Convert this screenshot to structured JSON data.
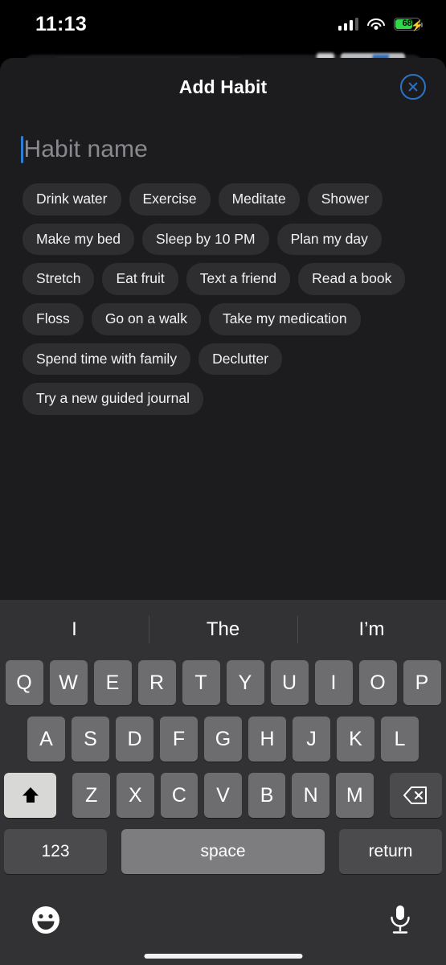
{
  "statusbar": {
    "time": "11:13",
    "cellular_icon": "cellular-signal-icon",
    "wifi_icon": "wifi-icon",
    "battery_percent": "68",
    "battery_charging": true,
    "battery_color": "#32d74b"
  },
  "sheet": {
    "title": "Add Habit",
    "close_icon": "close-circle-icon",
    "accent_color": "#2b74c4",
    "background_color": "#1c1c1e"
  },
  "input": {
    "value": "",
    "placeholder": "Habit name",
    "caret_color": "#2b7fd4"
  },
  "suggestions": [
    "Drink water",
    "Exercise",
    "Meditate",
    "Shower",
    "Make my bed",
    "Sleep by 10 PM",
    "Plan my day",
    "Stretch",
    "Eat fruit",
    "Text a friend",
    "Read a book",
    "Floss",
    "Go on a walk",
    "Take my medication",
    "Spend time with family",
    "Declutter",
    "Try a new guided journal"
  ],
  "keyboard": {
    "predictions": [
      "I",
      "The",
      "I’m"
    ],
    "row1": [
      "Q",
      "W",
      "E",
      "R",
      "T",
      "Y",
      "U",
      "I",
      "O",
      "P"
    ],
    "row2": [
      "A",
      "S",
      "D",
      "F",
      "G",
      "H",
      "J",
      "K",
      "L"
    ],
    "row3": [
      "Z",
      "X",
      "C",
      "V",
      "B",
      "N",
      "M"
    ],
    "shift_icon": "shift-arrow-icon",
    "shift_active": true,
    "backspace_icon": "backspace-delete-icon",
    "numbers_label": "123",
    "space_label": "space",
    "return_label": "return",
    "emoji_icon": "emoji-smiley-icon",
    "mic_icon": "microphone-icon",
    "background_color": "#323234",
    "key_color": "#6d6d6f"
  }
}
